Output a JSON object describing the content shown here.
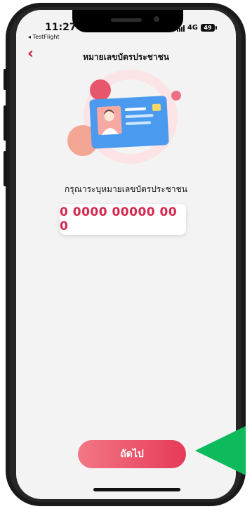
{
  "status_bar": {
    "time": "11:27",
    "back_app": "◂ TestFlight",
    "network": "4G",
    "battery": "49"
  },
  "header": {
    "back_icon": "chevron-left-icon",
    "title": "หมายเลขบัตรประชาชน"
  },
  "illustration": {
    "icon": "id-card-illustration",
    "colors": {
      "card_blue": "#3a8de8",
      "accent_pink": "#e23b5c",
      "avatar_bg": "#f39b98"
    }
  },
  "form": {
    "prompt": "กรุณาระบุหมายเลขบัตรประชาชน",
    "id_placeholder": "0 0000 00000 00 0"
  },
  "footer": {
    "next_label": "ถัดไป"
  },
  "annotation": {
    "arrow_color": "#0dba5c"
  },
  "colors": {
    "accent": "#d4294d",
    "background": "#f3f3f3"
  }
}
